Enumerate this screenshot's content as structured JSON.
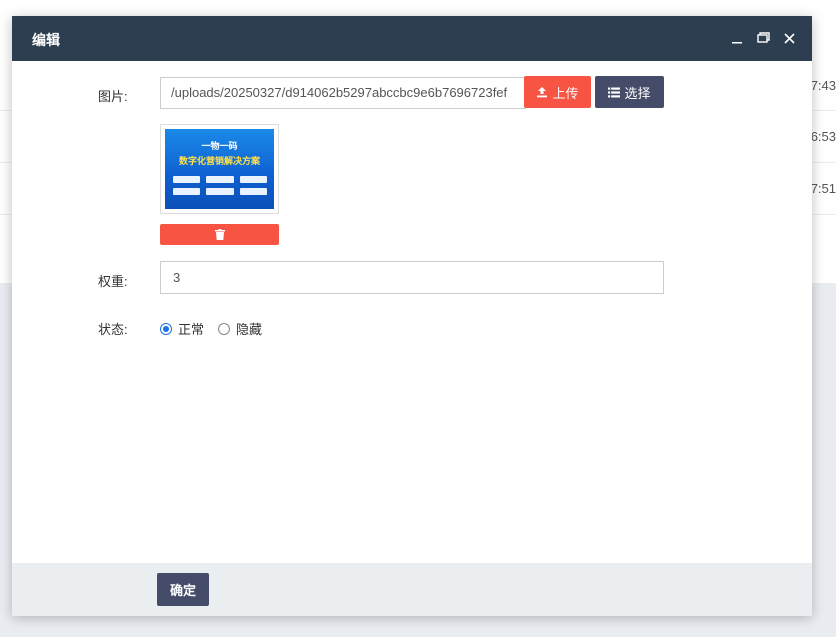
{
  "background": {
    "timestamps": [
      "7:43",
      "6:53",
      "7:51"
    ]
  },
  "modal": {
    "title": "编辑",
    "window_controls": [
      "minimize-icon",
      "maximize-icon",
      "close-icon"
    ]
  },
  "form": {
    "image": {
      "label": "图片:",
      "value": "/uploads/20250327/d914062b5297abccbc9e6b7696723fef",
      "upload_label": "上传",
      "choose_label": "选择",
      "preview": {
        "title": "一物一码",
        "subtitle": "数字化营销解决方案"
      }
    },
    "weight": {
      "label": "权重:",
      "value": "3"
    },
    "status": {
      "label": "状态:",
      "options": [
        {
          "label": "正常",
          "checked": true
        },
        {
          "label": "隐藏",
          "checked": false
        }
      ]
    }
  },
  "footer": {
    "confirm_label": "确定"
  },
  "colors": {
    "header": "#2c3e50",
    "danger": "#f75444",
    "primary_dark": "#444c69",
    "radio_checked": "#1a73e8"
  }
}
